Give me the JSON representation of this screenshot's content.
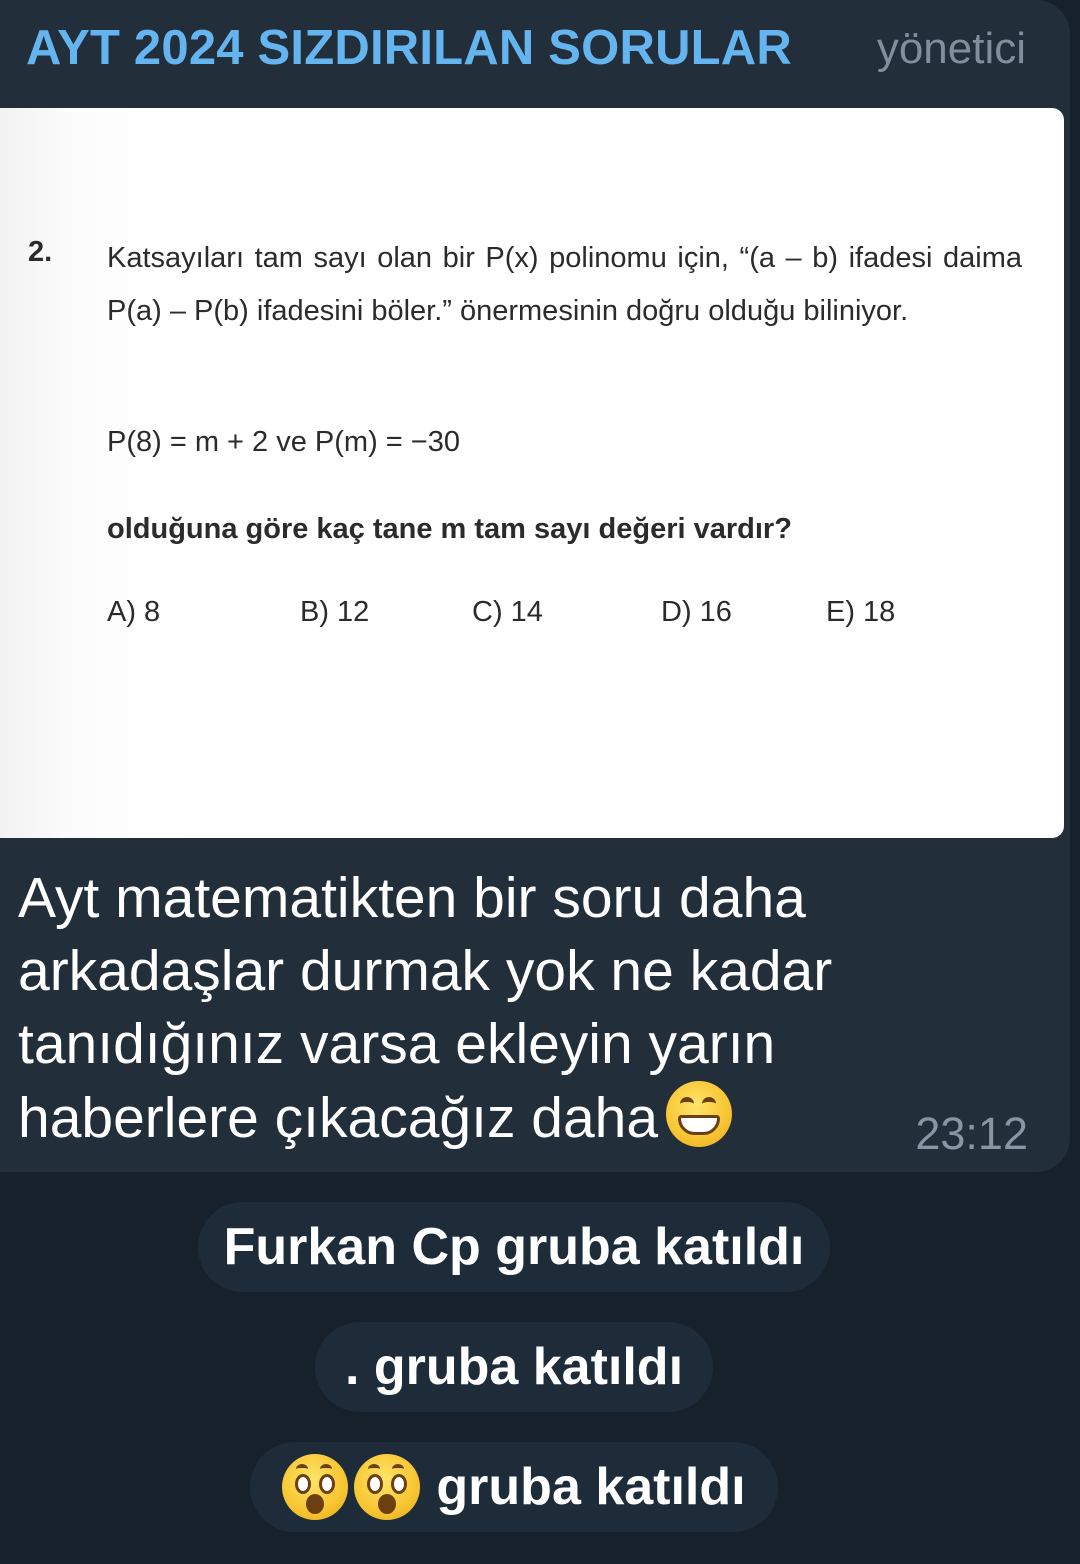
{
  "message": {
    "sender_name": "AYT 2024 SIZDIRILAN SORULAR",
    "sender_role": "yönetici",
    "photo": {
      "question_number": "2.",
      "question_text": "Katsayıları tam sayı olan bir P(x) polinomu için, “(a – b) ifadesi daima P(a) – P(b) ifadesini böler.” önermesinin doğru olduğu biliniyor.",
      "equation": "P(8) = m + 2 ve P(m) = −30",
      "ask": "olduğuna göre kaç tane m tam sayı değeri vardır?",
      "options": [
        "A) 8",
        "B) 12",
        "C) 14",
        "D) 16",
        "E) 18"
      ]
    },
    "caption": "Ayt matematikten bir soru daha arkadaşlar durmak yok ne kadar tanıdığınız varsa ekleyin yarın haberlere çıkacağız daha",
    "caption_emoji": "grinning-face-icon",
    "time": "23:12"
  },
  "service_messages": [
    {
      "text": "Furkan Cp gruba katıldı"
    },
    {
      "text": ". gruba katıldı"
    },
    {
      "text": "gruba katıldı",
      "emojis": [
        "hushed-face-icon",
        "hushed-face-icon"
      ]
    }
  ],
  "colors": {
    "background": "#17212b",
    "bubble": "#222e3a",
    "sender_name": "#64b5ef",
    "admin_badge": "#7f8f9e",
    "service_pill": "#1e2c3a"
  }
}
